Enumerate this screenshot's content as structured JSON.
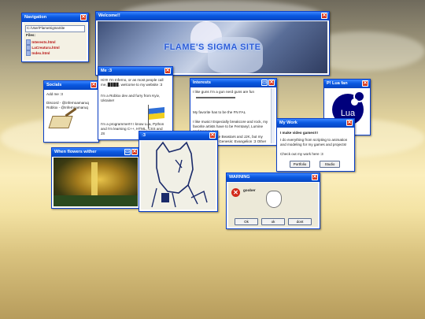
{
  "colors": {
    "titlebar": "#0a58e0",
    "close": "#d8381e",
    "link": "#b81414"
  },
  "navigation": {
    "title": "Navigation",
    "path": "C:/User/FlameSigmaSite",
    "files_label": "Files:",
    "files": [
      "Interests.html",
      "LaCreatura.html",
      "Index.html"
    ]
  },
  "welcome": {
    "title": "Welcome!!",
    "banner": "FLAME'S SIGMA SITE"
  },
  "me": {
    "title": "Me :3",
    "intro": "Hi!!!! I'm Inferno, or as most people call me, ▉▉▉▉, welcome to my website :3",
    "line2": "I'm a Roblox dev and furry from Kyiv, Ukraine!",
    "line3": "I'm a programmer!!! I know Lua, Python and I'm learning C++, HTML, CSS and JS"
  },
  "socials": {
    "title": "Socials",
    "add": "Add me :3",
    "discord": "Discord - @infernoamaruq",
    "roblox": "Roblox - @Infernoamaruq"
  },
  "interests": {
    "title": "Interests",
    "p1": "I like guns I'm a gun nerd guns are fun",
    "p2": "My favorite has to be the FN FAL",
    "p3": "I like music! Especially breakcore and rock, my favorite artists have to be Femtanyl, Lumine and Kemmunog",
    "p4": "I like anime! I like Beastars and JJK, but my favorite is Neon Genesis: Evangelion :3 Other than that, I also like Breaking Bad"
  },
  "lua": {
    "title": "P! Lua fan",
    "logo": "Lua"
  },
  "mywork": {
    "title": "My Work",
    "heading": "I make video games!!!",
    "body": "I do everything from scripting to animation and modeling for my games and projects!",
    "cta": "Check out my work here :3",
    "btn1": "Portfolio",
    "btn2": "Studio"
  },
  "flowers": {
    "title": "When flowers wither"
  },
  "drawing": {
    "title": ":3"
  },
  "warning": {
    "title": "WARNING",
    "message": "goober",
    "ok": "Ok",
    "ok2": "ok",
    "dont": "dont"
  }
}
